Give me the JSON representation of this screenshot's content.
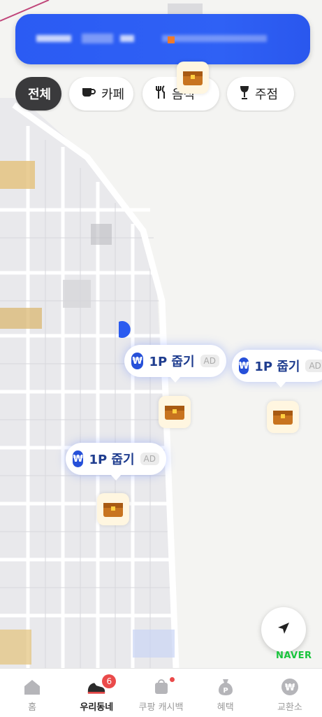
{
  "categories": [
    {
      "label": "전체",
      "icon": "all"
    },
    {
      "label": "카페",
      "icon": "coffee-cup-icon"
    },
    {
      "label": "음식",
      "icon": "fork-knife-icon"
    },
    {
      "label": "주점",
      "icon": "wine-glass-icon"
    }
  ],
  "map_markers": [
    {
      "label": "1P 줍기",
      "badge": "AD",
      "currency_symbol": "₩"
    },
    {
      "label": "1P 줍기",
      "badge": "AD",
      "currency_symbol": "₩"
    },
    {
      "label": "1P 줍기",
      "badge": "AD",
      "currency_symbol": "₩"
    }
  ],
  "map_brand": "NAVER",
  "tabs": [
    {
      "label": "홈",
      "icon": "home-icon"
    },
    {
      "label": "우리동네",
      "icon": "sneaker-icon",
      "badge": "6"
    },
    {
      "label": "쿠팡 캐시백",
      "icon": "shopping-bag-icon"
    },
    {
      "label": "혜택",
      "icon": "points-bag-icon"
    },
    {
      "label": "교환소",
      "icon": "won-coin-icon"
    }
  ],
  "colors": {
    "banner": "#2f61f5",
    "won_badge": "#2650d9",
    "naver_green": "#19c43c",
    "badge_red": "#ea4a4a"
  }
}
